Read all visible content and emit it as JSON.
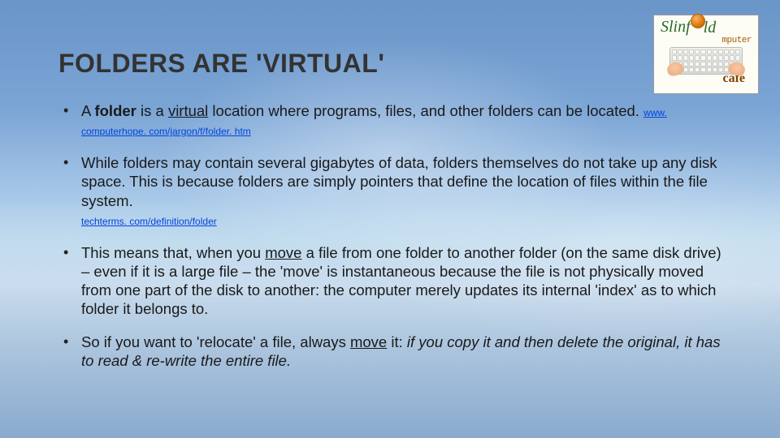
{
  "title": "FOLDERS ARE 'VIRTUAL'",
  "logo": {
    "top": "Slinf",
    "mid": "mputer",
    "alt_o": "o",
    "bottom": "cafe"
  },
  "bullets": {
    "b1": {
      "pre": "A ",
      "folder": "folder",
      "mid1": " is a ",
      "virtual": "virtual",
      "post": " location where programs, files, and other folders can be located. ",
      "link": "www. computerhope. com/jargon/f/folder. htm"
    },
    "b2": {
      "text": "While folders may contain several gigabytes of data, folders themselves do not take up any disk space. This is because folders are simply pointers that define the location of files within the file system. ",
      "link": "techterms. com/definition/folder"
    },
    "b3": {
      "pre": "This means that, when you ",
      "move": "move",
      "post": " a file from one folder to another folder (on the same disk drive) – even if it is a large file – the 'move' is instantaneous because the file is not physically moved from one part of the disk to another: the computer merely updates its internal 'index' as to which folder it belongs to."
    },
    "b4": {
      "pre": "So if you want to 'relocate' a file, always ",
      "move": "move",
      "mid": " it: ",
      "italic": "if you copy it and then delete the original, it has to read & re-write the entire file",
      "end": "."
    }
  }
}
